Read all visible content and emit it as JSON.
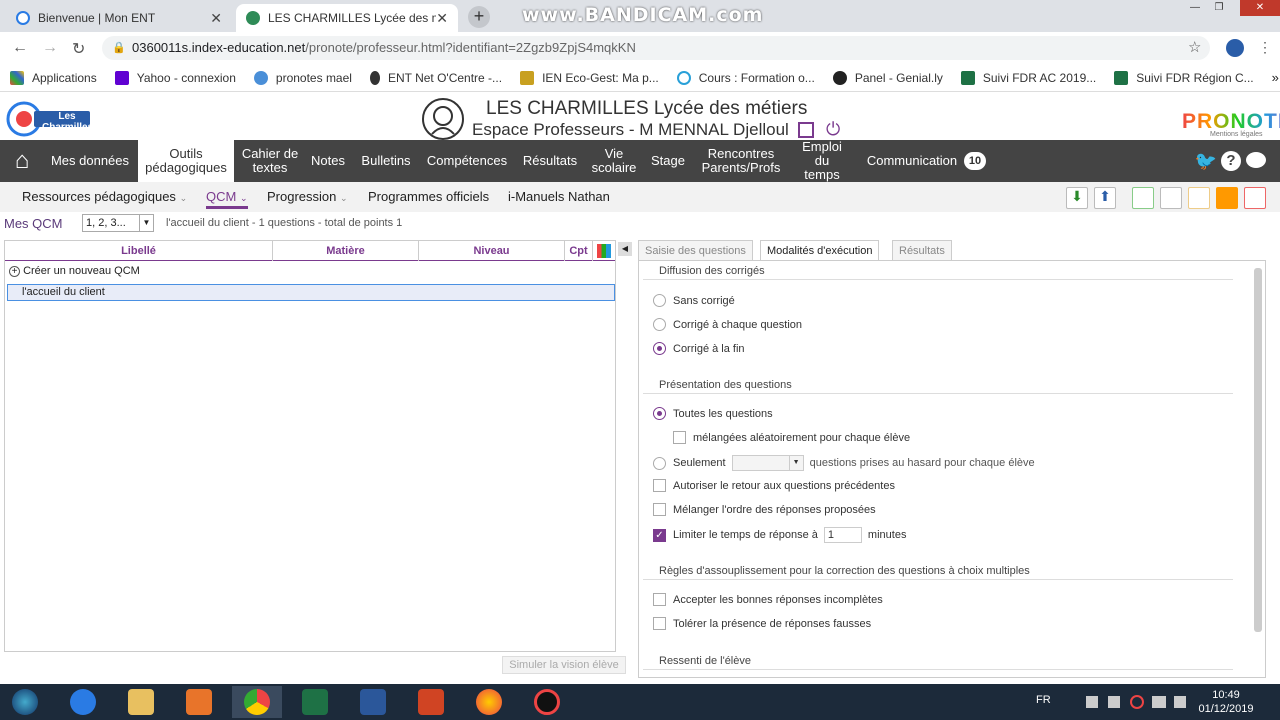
{
  "browser": {
    "tabs": [
      {
        "title": "Bienvenue | Mon ENT"
      },
      {
        "title": "LES CHARMILLES Lycée des métie"
      }
    ],
    "watermark": "www.BANDICAM.com",
    "url_host": "0360011s.index-education.net",
    "url_path": "/pronote/professeur.html?identifiant=2Zgzb9ZpjS4mqkKN",
    "bookmarks": [
      {
        "label": "Applications",
        "color": "#e44"
      },
      {
        "label": "Yahoo - connexion",
        "color": "#6001d2"
      },
      {
        "label": "pronotes mael",
        "color": "#4a8fd8"
      },
      {
        "label": "ENT Net O'Centre -...",
        "color": "#333"
      },
      {
        "label": "IEN Eco-Gest: Ma p...",
        "color": "#c8a020"
      },
      {
        "label": "Cours : Formation o...",
        "color": "#29a0d8"
      },
      {
        "label": "Panel - Genial.ly",
        "color": "#222"
      },
      {
        "label": "Suivi FDR AC 2019...",
        "color": "#1e7145"
      },
      {
        "label": "Suivi FDR Région C...",
        "color": "#1e7145"
      }
    ]
  },
  "header": {
    "logo_text": "Les Charmilles",
    "title": "LES CHARMILLES Lycée des métiers",
    "subtitle": "Espace Professeurs - M MENNAL Djelloul",
    "brand": "PRONOTE",
    "brand_sub": "Mentions légales"
  },
  "nav": {
    "items": [
      {
        "label": "Mes données"
      },
      {
        "label": "Outils pédagogiques"
      },
      {
        "label": "Cahier de textes"
      },
      {
        "label": "Notes"
      },
      {
        "label": "Bulletins"
      },
      {
        "label": "Compétences"
      },
      {
        "label": "Résultats"
      },
      {
        "label": "Vie scolaire"
      },
      {
        "label": "Stage"
      },
      {
        "label": "Rencontres Parents/Profs"
      },
      {
        "label": "Emploi du temps"
      },
      {
        "label": "Communication"
      }
    ],
    "badge": "10"
  },
  "subnav": {
    "items": [
      {
        "label": "Ressources pédagogiques"
      },
      {
        "label": "QCM"
      },
      {
        "label": "Progression"
      },
      {
        "label": "Programmes officiels"
      },
      {
        "label": "i-Manuels Nathan"
      }
    ]
  },
  "left": {
    "title": "Mes QCM",
    "select_value": "1, 2, 3...",
    "info": "l'accueil du client - 1 questions - total de points 1",
    "columns": [
      "Libellé",
      "Matière",
      "Niveau",
      "Cpt"
    ],
    "create_label": "Créer un nouveau QCM",
    "rows": [
      {
        "libelle": "l'accueil du client"
      }
    ],
    "simulate_button": "Simuler la vision élève"
  },
  "right": {
    "tabs": [
      "Saisie des questions",
      "Modalités d'exécution",
      "Résultats"
    ],
    "diffusion": {
      "title": "Diffusion des corrigés",
      "options": [
        "Sans corrigé",
        "Corrigé à chaque question",
        "Corrigé à la fin"
      ],
      "selected": 2
    },
    "presentation": {
      "title": "Présentation des questions",
      "all": "Toutes les questions",
      "shuffle": "mélangées aléatoirement pour chaque élève",
      "only": "Seulement",
      "only_suffix": "questions prises au hasard pour chaque élève",
      "back": "Autoriser le retour aux questions précédentes",
      "mix": "Mélanger l'ordre des réponses proposées",
      "limit": "Limiter le temps de réponse à",
      "limit_value": "1",
      "minutes": "minutes"
    },
    "regles": {
      "title": "Règles d'assouplissement pour la correction des questions à choix multiples",
      "accept": "Accepter les bonnes réponses incomplètes",
      "tolerate": "Tolérer la présence de réponses fausses"
    },
    "ressenti": "Ressenti de l'élève"
  },
  "taskbar": {
    "lang": "FR",
    "time": "10:49",
    "date": "01/12/2019",
    "apps": [
      "start",
      "ie",
      "explorer",
      "media",
      "chrome",
      "excel",
      "word",
      "powerpoint",
      "firefox",
      "bandicam"
    ]
  }
}
